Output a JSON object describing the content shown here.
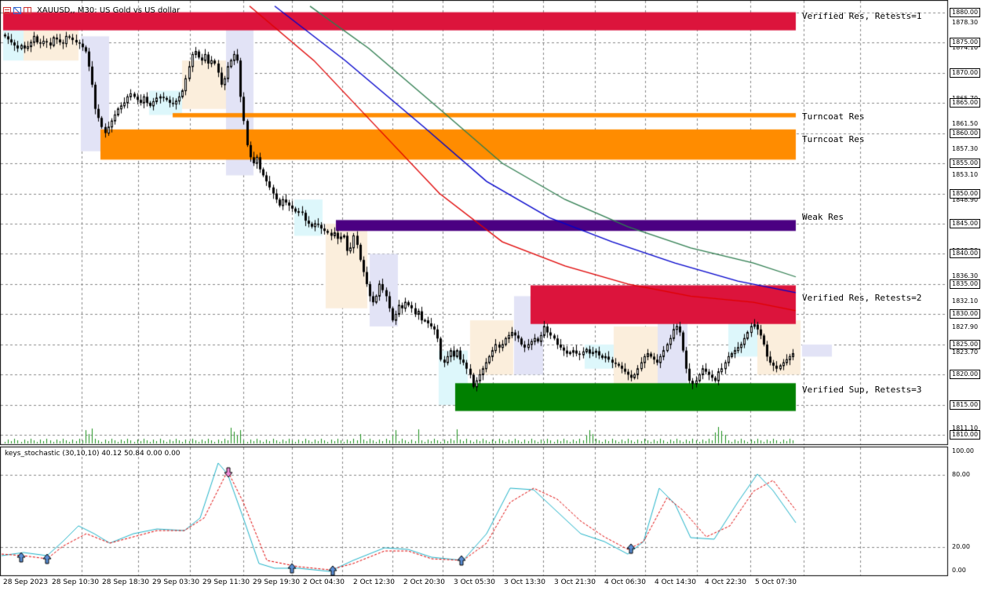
{
  "header": {
    "title": "XAUUSD,, M30:  US Gold vs US dollar"
  },
  "indicator": {
    "label": "keys_stochastic (30,10,10) 40.12 50.84 0.00 0.00"
  },
  "zones": [
    {
      "label": "Verified Res, Retests=1",
      "color": "#dc143c"
    },
    {
      "label": "Turncoat Res",
      "color": "#ff8c00"
    },
    {
      "label": "Turncoat Res",
      "color": "#ff8c00"
    },
    {
      "label": "Weak Res",
      "color": "#4b0082"
    },
    {
      "label": "Verified Res, Retests=2",
      "color": "#dc143c"
    },
    {
      "label": "Verified Sup, Retests=3",
      "color": "#008000"
    }
  ],
  "price_axis": {
    "boxed": [
      "1880.00",
      "1875.00",
      "1870.00",
      "1865.00",
      "1860.00",
      "1855.00",
      "1850.00",
      "1845.00",
      "1840.00",
      "1835.00",
      "1830.00",
      "1825.00",
      "1820.00",
      "1815.00",
      "1810.00"
    ],
    "plain": [
      "1878.30",
      "1874.10",
      "1869.90",
      "1865.70",
      "1861.50",
      "1857.30",
      "1853.10",
      "1848.90",
      "1844.70",
      "1840.50",
      "1836.30",
      "1832.10",
      "1827.90",
      "1823.70",
      "1819.50",
      "1815.30",
      "1811.10"
    ]
  },
  "indicator_axis": [
    "100.00",
    "80.00",
    "20.00",
    "0.00"
  ],
  "time_axis": [
    "28 Sep 2023",
    "28 Sep 10:30",
    "28 Sep 18:30",
    "29 Sep 03:30",
    "29 Sep 11:30",
    "29 Sep 19:30",
    "2 Oct 04:30",
    "2 Oct 12:30",
    "2 Oct 20:30",
    "3 Oct 05:30",
    "3 Oct 13:30",
    "3 Oct 21:30",
    "4 Oct 06:30",
    "4 Oct 14:30",
    "4 Oct 22:30",
    "5 Oct 07:30"
  ],
  "chart_data": {
    "type": "candlestick",
    "symbol": "XAUUSD",
    "timeframe": "M30",
    "ylim": [
      1808.5,
      1881.5
    ],
    "closes": [
      1876,
      1875.5,
      1875,
      1874.5,
      1874,
      1874.5,
      1874,
      1874.3,
      1875,
      1876,
      1875,
      1874.8,
      1875.2,
      1875,
      1874.5,
      1875.8,
      1875.5,
      1875,
      1874.8,
      1876,
      1875.8,
      1875.4,
      1875,
      1874.8,
      1874.2,
      1873.5,
      1871,
      1868,
      1864,
      1862.5,
      1861,
      1860,
      1861,
      1862,
      1863,
      1864,
      1864.5,
      1865,
      1866,
      1866.5,
      1866,
      1865.5,
      1865,
      1866,
      1865,
      1864.5,
      1865.2,
      1865.8,
      1866,
      1865.8,
      1865.5,
      1865,
      1864.8,
      1865.3,
      1866,
      1867,
      1869,
      1871,
      1873,
      1873.5,
      1872.5,
      1872,
      1873,
      1871.5,
      1872,
      1871.5,
      1870,
      1868,
      1869,
      1871,
      1872,
      1873,
      1872,
      1866,
      1862,
      1858,
      1856,
      1855,
      1856,
      1854,
      1853,
      1852,
      1851,
      1850,
      1849,
      1848,
      1849,
      1848.5,
      1848,
      1847.5,
      1847,
      1847,
      1846.8,
      1845.5,
      1845,
      1844.5,
      1845,
      1844.8,
      1844.2,
      1843.8,
      1843.5,
      1843,
      1843.5,
      1842.5,
      1842.8,
      1843,
      1840.5,
      1841,
      1843,
      1841.5,
      1839,
      1837,
      1835,
      1833,
      1832,
      1833,
      1835,
      1834,
      1833,
      1831,
      1829,
      1830,
      1831.5,
      1831,
      1832,
      1831.5,
      1831,
      1830,
      1830.5,
      1829,
      1829,
      1828.5,
      1828,
      1827.5,
      1826,
      1822.5,
      1822,
      1823,
      1824,
      1823,
      1824,
      1822.5,
      1822,
      1821,
      1820,
      1818,
      1819,
      1820,
      1821,
      1822,
      1823,
      1824,
      1825,
      1824.5,
      1825,
      1826,
      1826.5,
      1827,
      1826.5,
      1826,
      1825,
      1824.5,
      1825,
      1825.5,
      1826,
      1825.5,
      1826.5,
      1828,
      1827,
      1826.5,
      1826,
      1825,
      1824.5,
      1824,
      1823.5,
      1823.7,
      1824,
      1823.5,
      1823.3,
      1823.8,
      1824.2,
      1823.5,
      1823.7,
      1823.9,
      1823.2,
      1822.8,
      1823,
      1822.5,
      1822,
      1821.8,
      1821.5,
      1821,
      1820.5,
      1820,
      1819.5,
      1820,
      1821,
      1822,
      1823,
      1823.5,
      1823,
      1822.5,
      1822,
      1823,
      1824,
      1825,
      1826,
      1827.5,
      1828,
      1827,
      1824,
      1821,
      1819,
      1818.5,
      1819,
      1820,
      1821,
      1820.5,
      1820,
      1819.5,
      1819,
      1820.5,
      1821,
      1822,
      1823,
      1823.5,
      1824,
      1824.5,
      1825,
      1826,
      1827,
      1828,
      1828.3,
      1827.5,
      1826.5,
      1825,
      1823,
      1822,
      1821.5,
      1821,
      1821.5,
      1822,
      1822.5,
      1823,
      1823.5
    ]
  }
}
